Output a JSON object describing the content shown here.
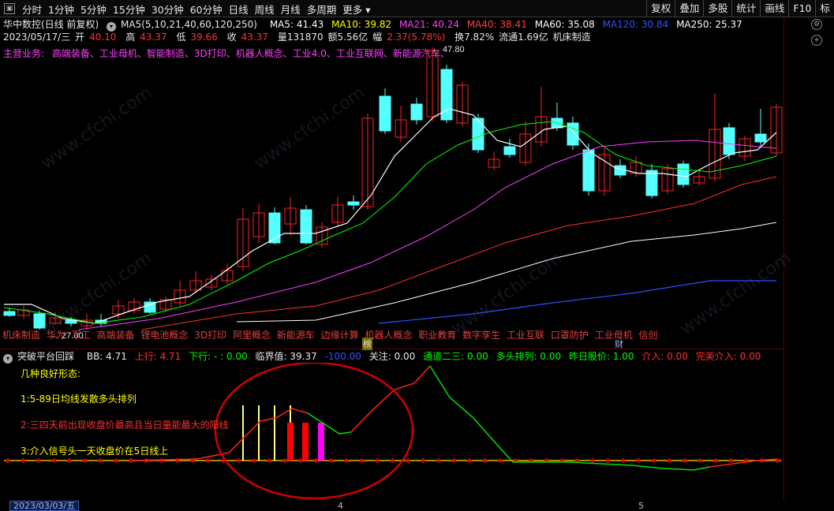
{
  "toolbar": {
    "periods": [
      "分时",
      "1分钟",
      "5分钟",
      "15分钟",
      "30分钟",
      "60分钟",
      "日线",
      "周线",
      "月线",
      "多周期",
      "更多"
    ],
    "right_buttons": [
      "复权",
      "叠加",
      "多股",
      "统计",
      "画线",
      "F10",
      "标"
    ]
  },
  "stock": {
    "title": "华中数控(日线 前复权)",
    "ma_settings": "MA5(5,10,21,40,60,120,250)",
    "mas": [
      {
        "label": "MA5: 41.43",
        "color": "#ffffff"
      },
      {
        "label": "MA10: 39.82",
        "color": "#ffff00"
      },
      {
        "label": "MA21: 40.24",
        "color": "#ff40ff"
      },
      {
        "label": "MA40: 38.41",
        "color": "#00ff00"
      },
      {
        "label": "MA60: 35.08",
        "color": "#ffffff"
      },
      {
        "label": "MA120: 30.84",
        "color": "#3050ff"
      },
      {
        "label": "MA250: 25.37",
        "color": "#ffffff"
      }
    ],
    "quote": {
      "date": "2023/05/17/三",
      "open_label": "开",
      "open": "40.10",
      "high_label": "高",
      "high": "43.37",
      "low_label": "低",
      "low": "39.66",
      "close_label": "收",
      "close": "43.37",
      "vol": "量131870",
      "amount": "额5.56亿",
      "chg_label": "幅",
      "chg": "2.37(5.78%)",
      "turnover": "换7.82%",
      "float": "流通1.69亿",
      "industry": "机床制造"
    },
    "business_label": "主营业务:",
    "business": "高端装备、工业母机、智能制造、3D打印、机器人概念、工业4.0、工业互联网、新能源汽车、",
    "high_mark": "47.80",
    "low_mark": "27.00"
  },
  "concepts": [
    "机床制造",
    "华为",
    "军工",
    "高端装备",
    "锂电池概念",
    "3D打印",
    "阿里概念",
    "新能源车",
    "边缘计算",
    "机器人概念",
    "职业教育",
    "数字孪生",
    "工业互联",
    "口罩防护",
    "工业母机",
    "信创"
  ],
  "badges": {
    "bang": "榜",
    "cai": "财"
  },
  "indicator": {
    "name": "突破平台回踩",
    "bb": "BB: 4.71",
    "up": "上行: 4.71",
    "down": "下行: - : 0.00",
    "critical": "临界值: 39.37",
    "neg": "-100.00",
    "focus": "关注: 0.00",
    "channel": "通道二三: 0.00",
    "bull": "多头排列: 0.00",
    "prev": "昨日股价: 1.00",
    "entry": "介入: 0.00",
    "perfect": "完美介入: 0.00"
  },
  "notes": {
    "title": "几种良好形态:",
    "n1": "1:5-89日均线发散多头排列",
    "n2": "2:三四天前出现收盘价最高且当日量能最大的阳线",
    "n3": "3:介入信号头一天收盘价在5日线上"
  },
  "bottom": {
    "date": "2023/03/03/五",
    "t1": "4",
    "t2": "5"
  },
  "watermark": "www.cfchi.com",
  "colors": {
    "up": "#ff2020",
    "down": "#54ffff",
    "ma5": "#ffffff",
    "ma10": "#ffff00",
    "ma21": "#ff40ff",
    "ma40": "#00ff00",
    "ma120": "#3050ff",
    "ma250": "#ffffff",
    "circle": "#e00000"
  }
}
